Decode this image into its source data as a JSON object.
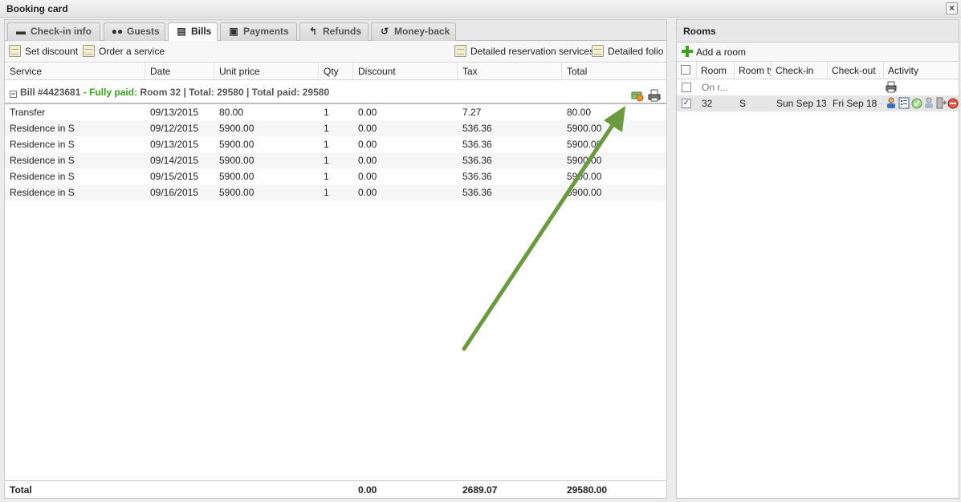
{
  "window": {
    "title": "Booking card",
    "close_icon": "close-icon"
  },
  "tabs": [
    {
      "label": "Check-in info",
      "icon": "briefcase-icon"
    },
    {
      "label": "Guests",
      "icon": "users-icon"
    },
    {
      "label": "Bills",
      "icon": "document-icon",
      "active": true
    },
    {
      "label": "Payments",
      "icon": "money-icon"
    },
    {
      "label": "Refunds",
      "icon": "reply-icon"
    },
    {
      "label": "Money-back",
      "icon": "undo-icon"
    }
  ],
  "toolbar": {
    "set_discount": "Set discount",
    "order_service": "Order a service",
    "detailed_services": "Detailed reservation services",
    "detailed_folio": "Detailed folio"
  },
  "columns": [
    "Service",
    "Date",
    "Unit price",
    "Qty",
    "Discount",
    "Tax",
    "Total"
  ],
  "bill": {
    "number": "Bill #4423681",
    "status": "- Fully paid:",
    "summary": "Room 32 | Total: 29580 | Total paid: 29580"
  },
  "rows": [
    {
      "service": "Transfer",
      "date": "09/13/2015",
      "unit_price": "80.00",
      "qty": "1",
      "discount": "0.00",
      "tax": "7.27",
      "total": "80.00"
    },
    {
      "service": "Residence in S",
      "date": "09/12/2015",
      "unit_price": "5900.00",
      "qty": "1",
      "discount": "0.00",
      "tax": "536.36",
      "total": "5900.00"
    },
    {
      "service": "Residence in S",
      "date": "09/13/2015",
      "unit_price": "5900.00",
      "qty": "1",
      "discount": "0.00",
      "tax": "536.36",
      "total": "5900.00"
    },
    {
      "service": "Residence in S",
      "date": "09/14/2015",
      "unit_price": "5900.00",
      "qty": "1",
      "discount": "0.00",
      "tax": "536.36",
      "total": "5900.00"
    },
    {
      "service": "Residence in S",
      "date": "09/15/2015",
      "unit_price": "5900.00",
      "qty": "1",
      "discount": "0.00",
      "tax": "536.36",
      "total": "5900.00"
    },
    {
      "service": "Residence in S",
      "date": "09/16/2015",
      "unit_price": "5900.00",
      "qty": "1",
      "discount": "0.00",
      "tax": "536.36",
      "total": "5900.00"
    }
  ],
  "totals": {
    "label": "Total",
    "discount": "0.00",
    "tax": "2689.07",
    "total": "29580.00"
  },
  "rooms": {
    "title": "Rooms",
    "add_room": "Add a room",
    "columns": [
      "Room",
      "Room ty",
      "Check-in",
      "Check-out",
      "Activity"
    ],
    "on_request": "On r...",
    "rows": [
      {
        "room": "32",
        "room_type": "S",
        "check_in": "Sun Sep 13",
        "check_out": "Fri Sep 18",
        "checked": true
      }
    ]
  },
  "colors": {
    "paid_green": "#3aa61f",
    "arrow_green": "#6b9a3e"
  }
}
